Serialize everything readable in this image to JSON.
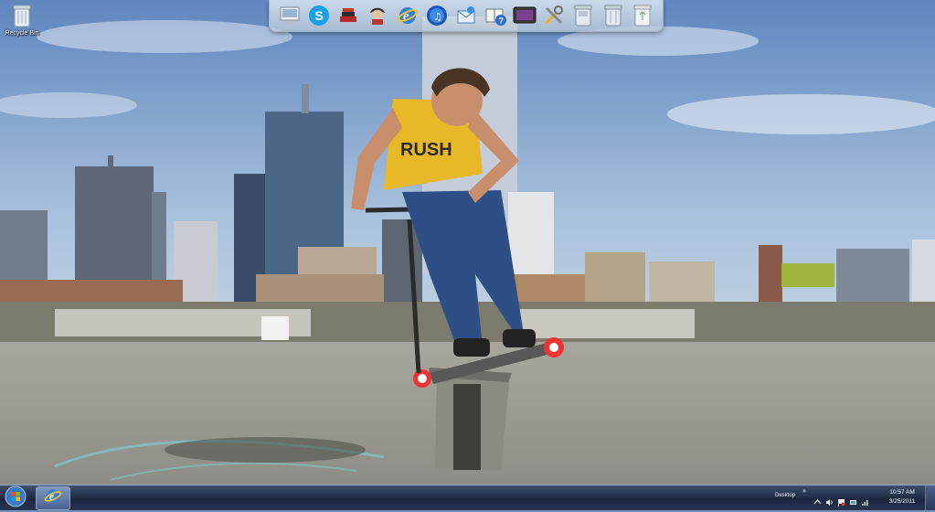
{
  "desktop": {
    "icons": [
      {
        "label": "Recycle Bin",
        "icon": "recycle-bin-icon"
      }
    ]
  },
  "dock": {
    "items": [
      {
        "icon": "computer-icon"
      },
      {
        "icon": "skype-icon"
      },
      {
        "icon": "books-icon"
      },
      {
        "icon": "avatar-icon"
      },
      {
        "icon": "internet-explorer-icon"
      },
      {
        "icon": "music-player-icon"
      },
      {
        "icon": "mail-icon"
      },
      {
        "icon": "help-book-icon"
      },
      {
        "icon": "monitor-icon"
      },
      {
        "icon": "tools-icon"
      },
      {
        "icon": "trash-full-icon"
      },
      {
        "icon": "trash-icon"
      },
      {
        "icon": "trash-empty-icon"
      }
    ]
  },
  "taskbar": {
    "start_icon": "windows-orb-icon",
    "pinned": [
      {
        "icon": "internet-explorer-icon"
      }
    ],
    "desktop_toolbar_label": "Desktop",
    "toolbar_chevron": "»",
    "tray": [
      "arrow-up-icon",
      "volume-icon",
      "flag-icon",
      "network-icon",
      "signal-icon"
    ],
    "clock": {
      "time": "10:57 AM",
      "date": "3/25/2011"
    }
  },
  "colors": {
    "sky": "#7e9fc9",
    "ground": "#9a9a92",
    "taskbar": "#1c2840",
    "dock": "#dfe8f1"
  }
}
